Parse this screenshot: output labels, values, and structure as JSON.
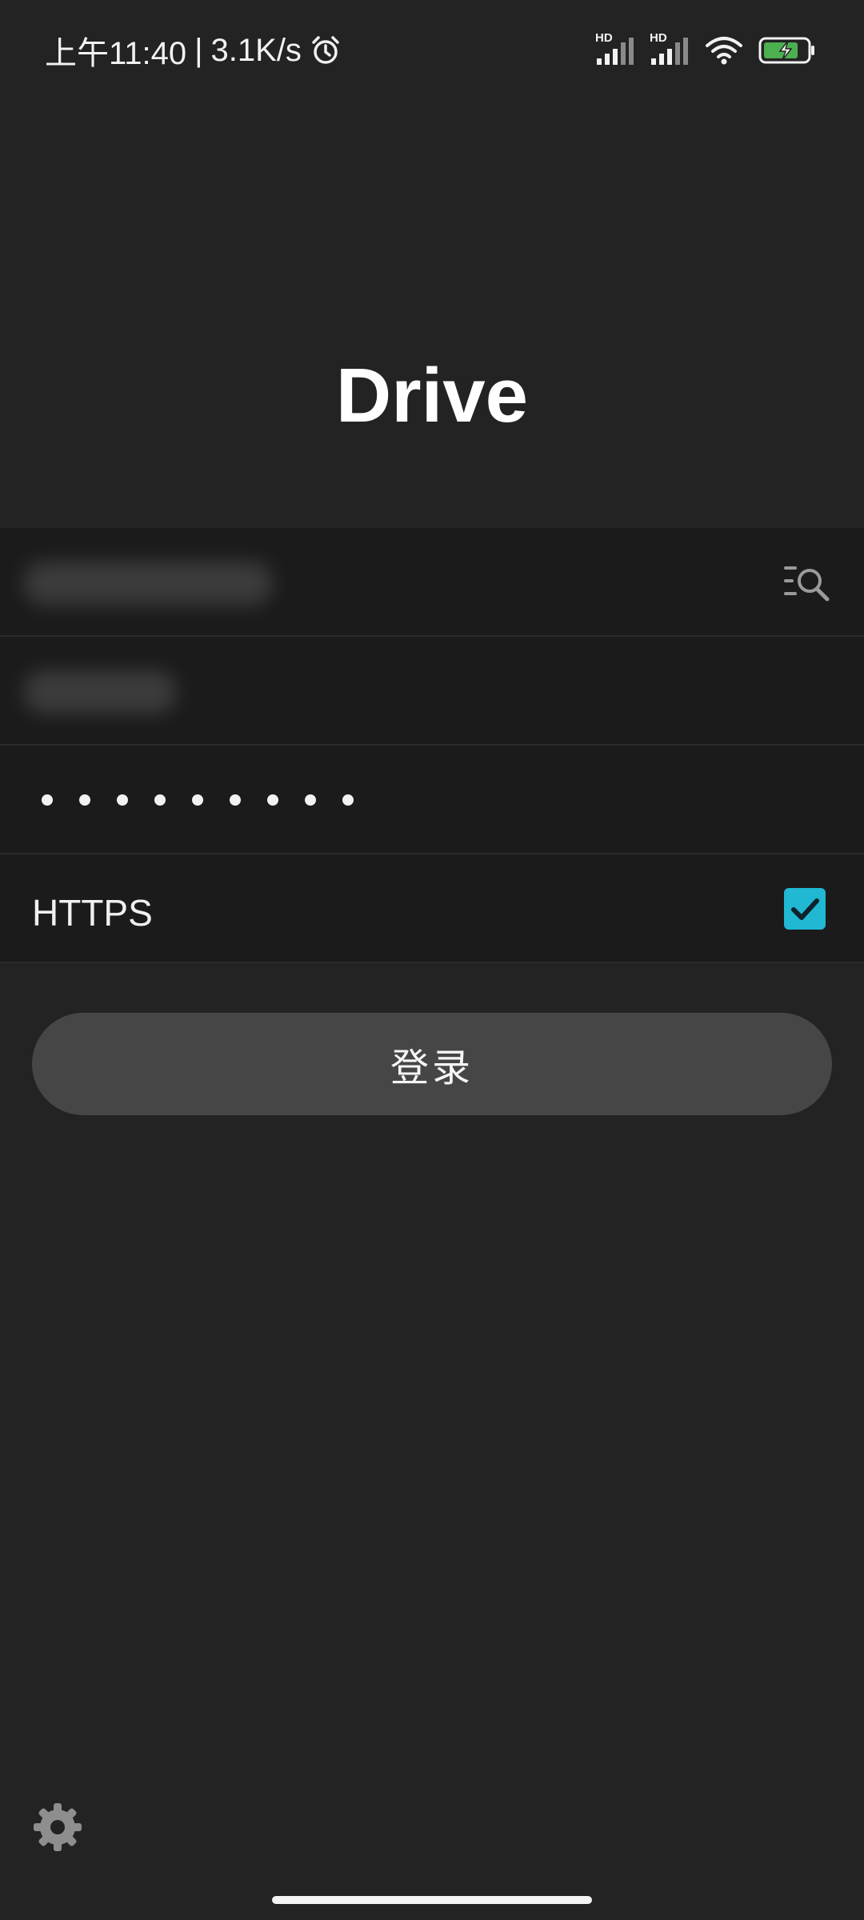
{
  "status_bar": {
    "time": "上午11:40",
    "separator": "|",
    "net_speed": "3.1K/s",
    "alarm_icon": "alarm-icon",
    "signal1_label": "HD",
    "signal2_label": "HD",
    "wifi_icon": "wifi-icon",
    "battery_icon": "battery-charging-icon",
    "battery_color": "#4caf50"
  },
  "app": {
    "title": "Drive"
  },
  "form": {
    "host_field_icon": "history-search-icon",
    "password_mask_length": 9,
    "https_label": "HTTPS",
    "https_checked": true,
    "checkbox_color": "#20b8d3"
  },
  "login_button_label": "登录",
  "settings_icon": "gear-icon"
}
